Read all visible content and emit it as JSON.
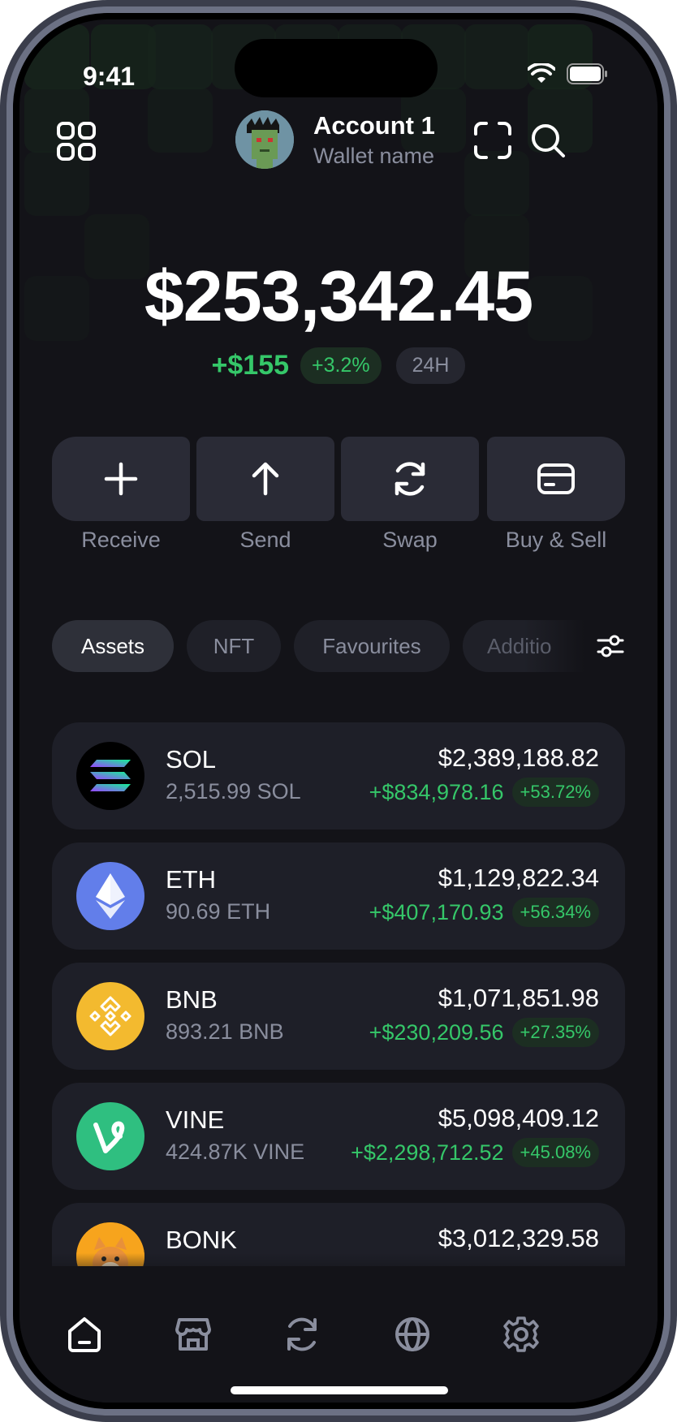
{
  "status_bar": {
    "time": "9:41"
  },
  "header": {
    "account_name": "Account 1",
    "wallet_name": "Wallet name"
  },
  "portfolio": {
    "balance": "$253,342.45",
    "change_usd": "+$155",
    "change_pct": "+3.2%",
    "period": "24H"
  },
  "actions": [
    {
      "label": "Receive",
      "icon": "plus-icon"
    },
    {
      "label": "Send",
      "icon": "arrow-up-icon"
    },
    {
      "label": "Swap",
      "icon": "refresh-icon"
    },
    {
      "label": "Buy & Sell",
      "icon": "card-icon"
    }
  ],
  "tabs": [
    {
      "label": "Assets",
      "active": true
    },
    {
      "label": "NFT",
      "active": false
    },
    {
      "label": "Favourites",
      "active": false
    },
    {
      "label": "Additio",
      "active": false
    }
  ],
  "assets": [
    {
      "symbol": "SOL",
      "amount": "2,515.99 SOL",
      "value": "$2,389,188.82",
      "change": "+$834,978.16",
      "pct": "+53.72%",
      "color": "#000000"
    },
    {
      "symbol": "ETH",
      "amount": "90.69 ETH",
      "value": "$1,129,822.34",
      "change": "+$407,170.93",
      "pct": "+56.34%",
      "color": "#627eea"
    },
    {
      "symbol": "BNB",
      "amount": "893.21 BNB",
      "value": "$1,071,851.98",
      "change": "+$230,209.56",
      "pct": "+27.35%",
      "color": "#f3ba2f"
    },
    {
      "symbol": "VINE",
      "amount": "424.87K VINE",
      "value": "$5,098,409.12",
      "change": "+$2,298,712.52",
      "pct": "+45.08%",
      "color": "#2fbf80"
    },
    {
      "symbol": "BONK",
      "amount": "",
      "value": "$3,012,329.58",
      "change": "",
      "pct": "",
      "color": "#f59e0b"
    }
  ],
  "nav": [
    {
      "name": "home",
      "icon": "home-icon",
      "active": true
    },
    {
      "name": "marketplace",
      "icon": "store-icon",
      "active": false
    },
    {
      "name": "swap",
      "icon": "refresh-icon",
      "active": false
    },
    {
      "name": "browser",
      "icon": "globe-icon",
      "active": false
    },
    {
      "name": "settings",
      "icon": "gear-icon",
      "active": false
    }
  ],
  "colors": {
    "accent_green": "#35c769",
    "background": "#131318",
    "card": "#1e1f28"
  }
}
